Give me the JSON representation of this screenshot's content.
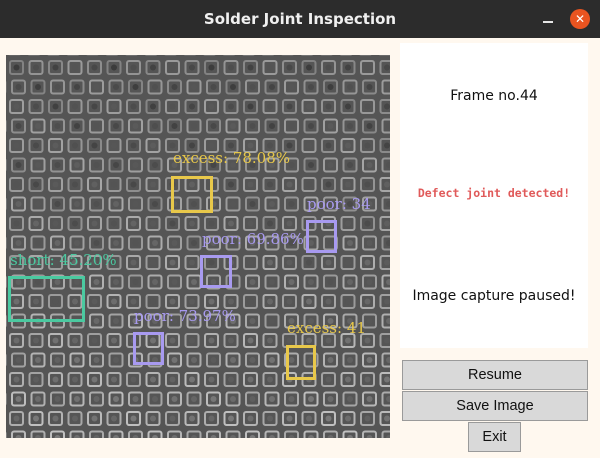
{
  "window": {
    "title": "Solder Joint Inspection"
  },
  "titlebar": {
    "close_glyph": "✕"
  },
  "detections": [
    {
      "label": "excess: 78.08%",
      "color": "#e8c84a"
    },
    {
      "label": "poor: 34",
      "color": "#a89af0"
    },
    {
      "label": "poor: 69.86%",
      "color": "#a89af0"
    },
    {
      "label": "short: 45.20%",
      "color": "#4bc9a0"
    },
    {
      "label": "poor: 73.97%",
      "color": "#a89af0"
    },
    {
      "label": "excess: 41",
      "color": "#e8c84a"
    }
  ],
  "status": {
    "frame": "Frame no.44",
    "alert": "Defect joint detected!",
    "capture": "Image capture paused!"
  },
  "buttons": {
    "resume": "Resume",
    "save": "Save Image",
    "exit": "Exit"
  },
  "colors": {
    "alert": "#e05a5a",
    "titlebar": "#2c2c2c",
    "close": "#e95420"
  }
}
